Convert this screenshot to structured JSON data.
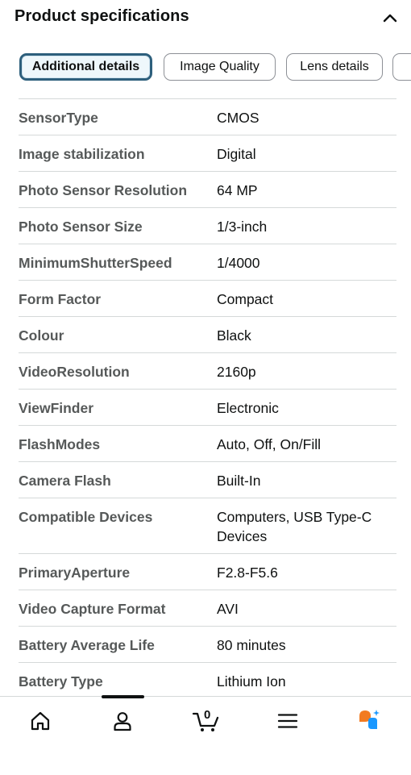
{
  "header": {
    "title": "Product specifications"
  },
  "tabs": [
    {
      "label": "Additional details",
      "active": true
    },
    {
      "label": "Image Quality",
      "active": false
    },
    {
      "label": "Lens details",
      "active": false
    }
  ],
  "specs": [
    {
      "key": "SensorType",
      "value": "CMOS"
    },
    {
      "key": "Image stabilization",
      "value": "Digital"
    },
    {
      "key": "Photo Sensor Resolution",
      "value": "64 MP"
    },
    {
      "key": "Photo Sensor Size",
      "value": "1/3-inch"
    },
    {
      "key": "MinimumShutterSpeed",
      "value": "1/4000"
    },
    {
      "key": "Form Factor",
      "value": "Compact"
    },
    {
      "key": "Colour",
      "value": "Black"
    },
    {
      "key": "VideoResolution",
      "value": "2160p"
    },
    {
      "key": "ViewFinder",
      "value": "Electronic"
    },
    {
      "key": "FlashModes",
      "value": "Auto, Off, On/Fill"
    },
    {
      "key": "Camera Flash",
      "value": "Built-In"
    },
    {
      "key": "Compatible Devices",
      "value": "Computers, USB Type-C Devices"
    },
    {
      "key": "PrimaryAperture",
      "value": "F2.8-F5.6"
    },
    {
      "key": "Video Capture Format",
      "value": "AVI"
    },
    {
      "key": "Battery Average Life",
      "value": "80 minutes"
    },
    {
      "key": "Battery Type",
      "value": "Lithium Ion"
    }
  ],
  "bottom_nav": {
    "cart_count": "0",
    "icons": [
      "home-icon",
      "account-icon",
      "cart-icon",
      "menu-icon",
      "rufus-icon"
    ]
  },
  "colors": {
    "active_chip_border": "#2d5f7c",
    "rufus_orange": "#f27b21",
    "rufus_blue": "#1a98ff"
  }
}
